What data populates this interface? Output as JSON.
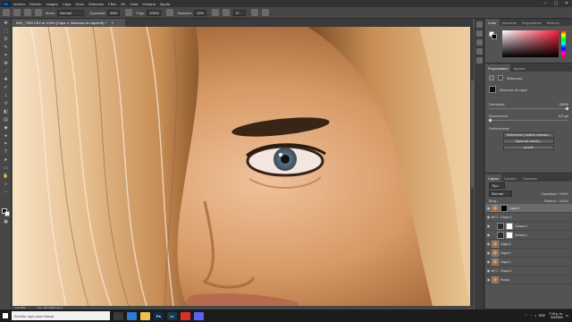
{
  "app": {
    "logo_text": "Ps"
  },
  "menu": [
    "Archivo",
    "Edición",
    "Imagen",
    "Capa",
    "Texto",
    "Selección",
    "Filtro",
    "3D",
    "Vista",
    "Ventana",
    "Ayuda"
  ],
  "window_controls": [
    "–",
    "▢",
    "✕"
  ],
  "options": {
    "mode_label": "Modo:",
    "mode_value": "Normal",
    "opacity_label": "Opacidad:",
    "opacity_value": "80%",
    "flow_label": "Flujo:",
    "flow_value": "100%",
    "smoothing_label": "Suavizar:",
    "smoothing_value": "10%",
    "angle_value": "0°"
  },
  "document": {
    "tab_title": "IMG_7355.CR2 al 104% (Capa 4, Máscara de capa/16) *",
    "close": "✕"
  },
  "status": {
    "zoom": "104,05%",
    "doc_size": "Doc: 68,5 MB/1,22 G"
  },
  "right_panels": {
    "color_tabs": [
      "Color",
      "Muestras",
      "Degradados",
      "Motivos"
    ],
    "properties_tabs": [
      "Propiedades",
      "Ajustes"
    ],
    "properties": {
      "mask_label": "Máscaras",
      "layer_mask_label": "Máscara de capa",
      "density_label": "Densidad:",
      "density_value": "100%",
      "feather_label": "Desvanecer:",
      "feather_value": "0,0 px",
      "refine_label": "Perfeccionar:",
      "btn_select_mask": "Seleccionar y aplicar máscara...",
      "btn_color_range": "Gama de colores...",
      "btn_invert": "Invertir"
    },
    "layers_tabs": [
      "Capas",
      "Canales",
      "Trazados"
    ],
    "layers_filter": "Tipo",
    "blend_mode": "Normal",
    "opacity_label": "Opacidad:",
    "opacity_value": "100%",
    "lock_label": "Bloq.:",
    "fill_label": "Relleno:",
    "fill_value": "100%",
    "layers": [
      {
        "name": "Capa 4",
        "thumb": "face",
        "mask": true,
        "active": true,
        "indent": false
      },
      {
        "name": "Grupo 2",
        "thumb": "folder",
        "mask": false,
        "active": false,
        "indent": false
      },
      {
        "name": "Curvas 2",
        "thumb": "adj",
        "mask": true,
        "active": false,
        "indent": true
      },
      {
        "name": "Curvas 1",
        "thumb": "adj",
        "mask": true,
        "active": false,
        "indent": true
      },
      {
        "name": "Capa 3",
        "thumb": "face",
        "mask": false,
        "active": false,
        "indent": false
      },
      {
        "name": "Capa 2",
        "thumb": "face",
        "mask": false,
        "active": false,
        "indent": false
      },
      {
        "name": "Capa 1",
        "thumb": "face",
        "mask": false,
        "active": false,
        "indent": false
      },
      {
        "name": "Grupo 1",
        "thumb": "folder",
        "mask": false,
        "active": false,
        "indent": false
      },
      {
        "name": "Fondo",
        "thumb": "face",
        "mask": false,
        "active": false,
        "indent": false
      }
    ]
  },
  "taskbar": {
    "search_placeholder": "Escribe aquí para buscar",
    "apps": [
      {
        "label": "",
        "color": "#3a3a3a"
      },
      {
        "label": "",
        "color": "#2d7dd2"
      },
      {
        "label": "",
        "color": "#f2c14e"
      },
      {
        "label": "Ps",
        "color": "#0d2b4a"
      },
      {
        "label": "Lr",
        "color": "#123a52"
      },
      {
        "label": "",
        "color": "#d93025"
      },
      {
        "label": "",
        "color": "#5865f2"
      }
    ],
    "tray_lang": "ESP",
    "time": "7:19 p. m.",
    "date": "9/4/2020"
  }
}
